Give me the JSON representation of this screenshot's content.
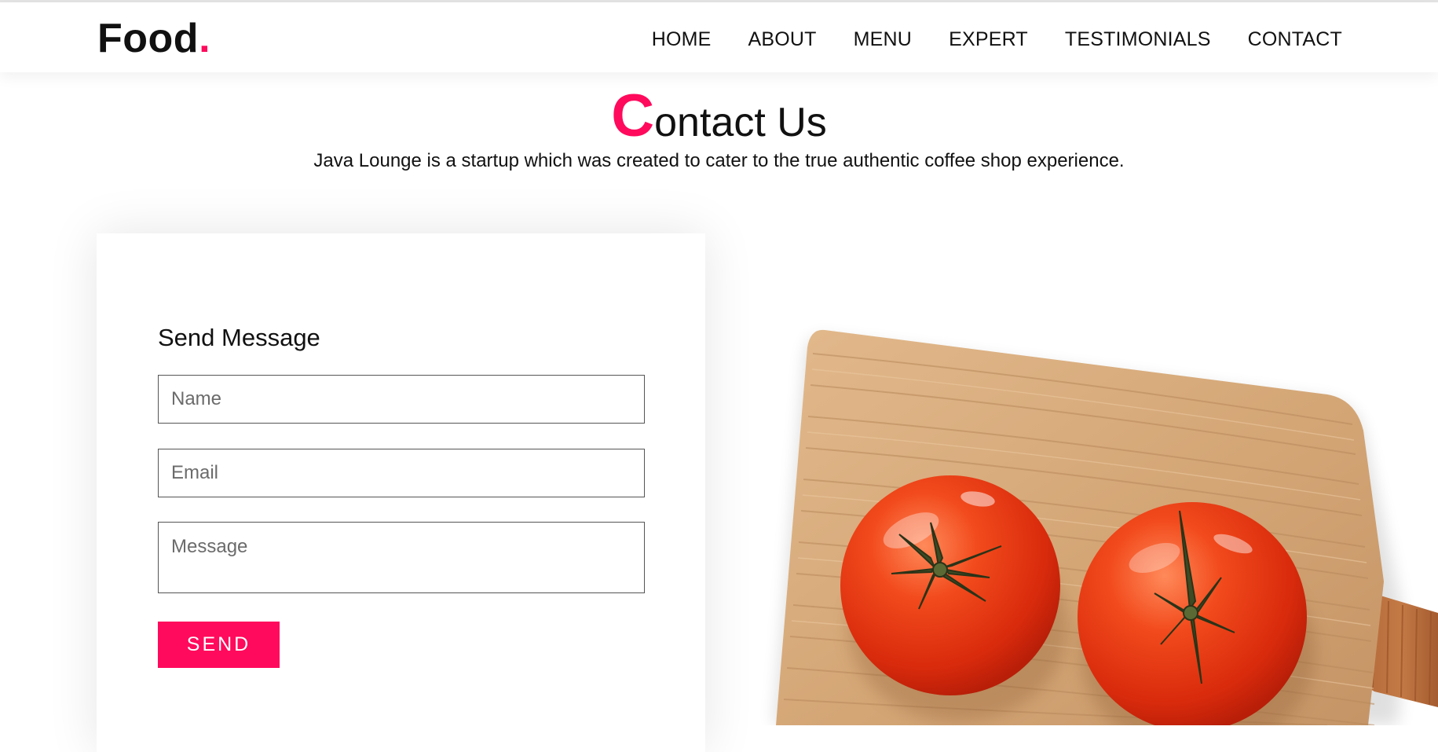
{
  "brand": {
    "name": "Food",
    "dot": ".",
    "accent_color": "#ff0a5c"
  },
  "nav": {
    "items": [
      {
        "label": "HOME"
      },
      {
        "label": "ABOUT"
      },
      {
        "label": "MENU"
      },
      {
        "label": "EXPERT"
      },
      {
        "label": "TESTIMONIALS"
      },
      {
        "label": "CONTACT"
      }
    ]
  },
  "section": {
    "title_first_letter": "C",
    "title_rest": "ontact Us",
    "subtitle": "Java Lounge is a startup which was created to cater to the true authentic coffee shop experience."
  },
  "form": {
    "title": "Send Message",
    "name_placeholder": "Name",
    "email_placeholder": "Email",
    "message_placeholder": "Message",
    "send_label": "SEND"
  },
  "image": {
    "subject": "two tomatoes on wooden cutting board"
  }
}
